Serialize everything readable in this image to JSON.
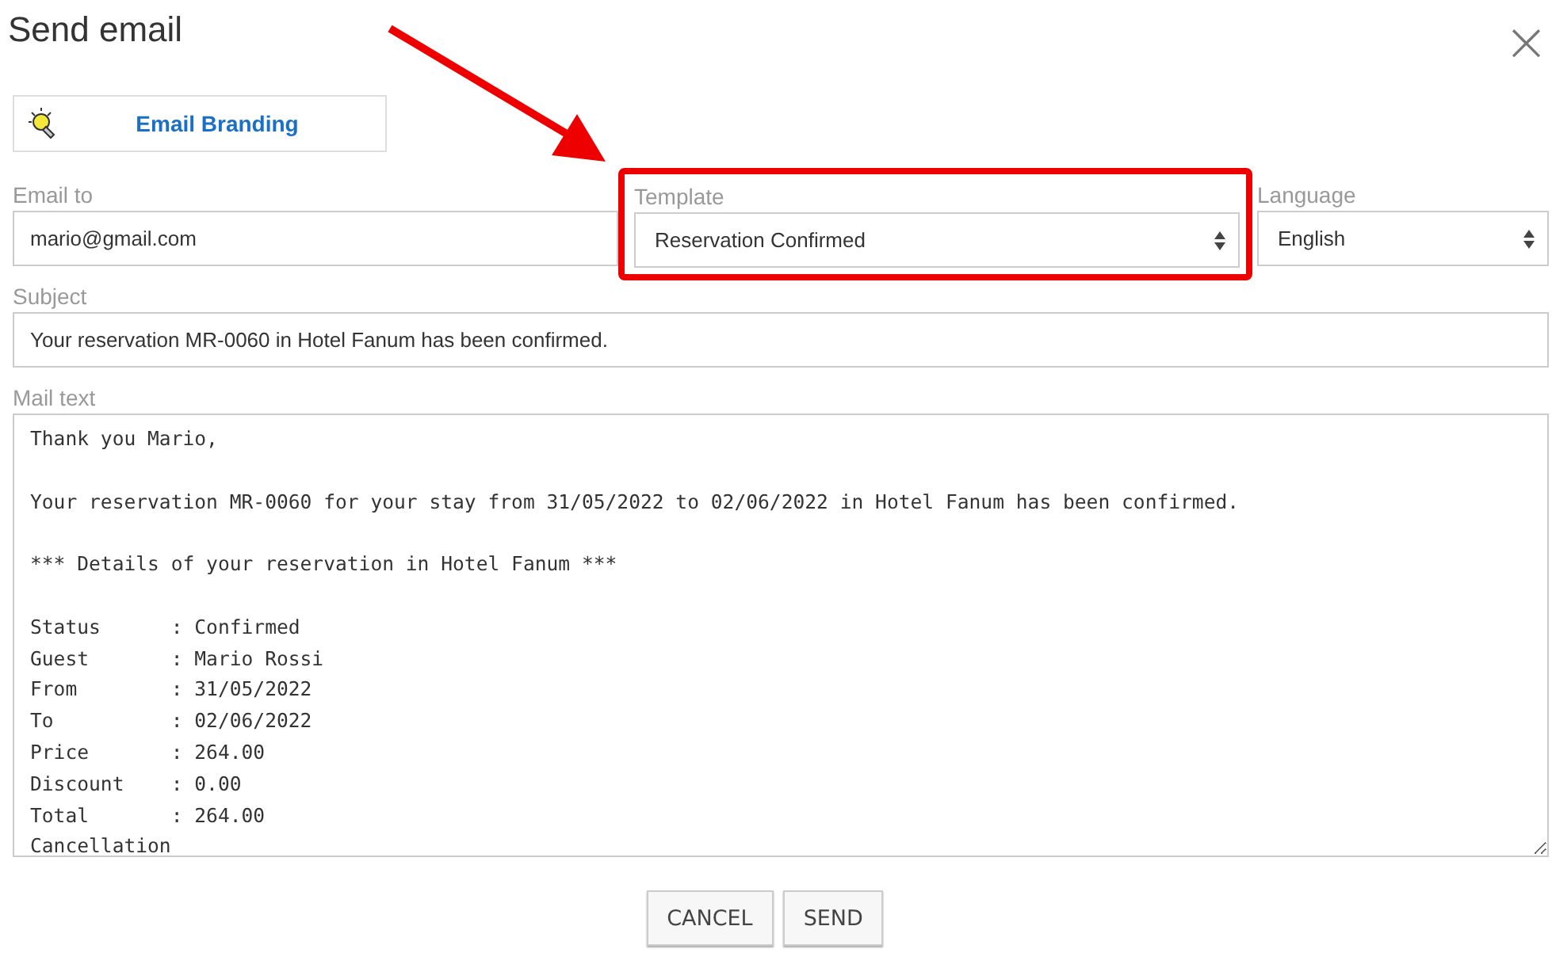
{
  "dialog": {
    "title": "Send email",
    "close": "×"
  },
  "branding_button": {
    "label": "Email Branding"
  },
  "fields": [
    {
      "kind": "input",
      "label": "Email to",
      "value": "mario@gmail.com",
      "highlighted": false
    },
    {
      "kind": "select",
      "label": "Template",
      "value": "Reservation Confirmed",
      "highlighted": true
    },
    {
      "kind": "select",
      "label": "Language",
      "value": "English",
      "highlighted": false
    }
  ],
  "subject": {
    "label": "Subject",
    "value": "Your reservation MR-0060 in Hotel Fanum has been confirmed."
  },
  "mail_text": {
    "label": "Mail text",
    "paragraphs": [
      [
        "Thank you Mario,"
      ],
      [
        "Your reservation MR-0060 for your stay from 31/05/2022 to 02/06/2022 in Hotel Fanum has been confirmed."
      ],
      [
        "*** Details of your reservation in Hotel Fanum ***"
      ],
      [
        "Status      : Confirmed",
        "Guest       : Mario Rossi",
        "From        : 31/05/2022",
        "To          : 02/06/2022",
        "Price       : 264.00",
        "Discount    : 0.00",
        "Total       : 264.00",
        "Cancellation"
      ]
    ]
  },
  "buttons": [
    {
      "label": "CANCEL"
    },
    {
      "label": "SEND"
    }
  ],
  "annotation": {
    "arrow": true
  }
}
